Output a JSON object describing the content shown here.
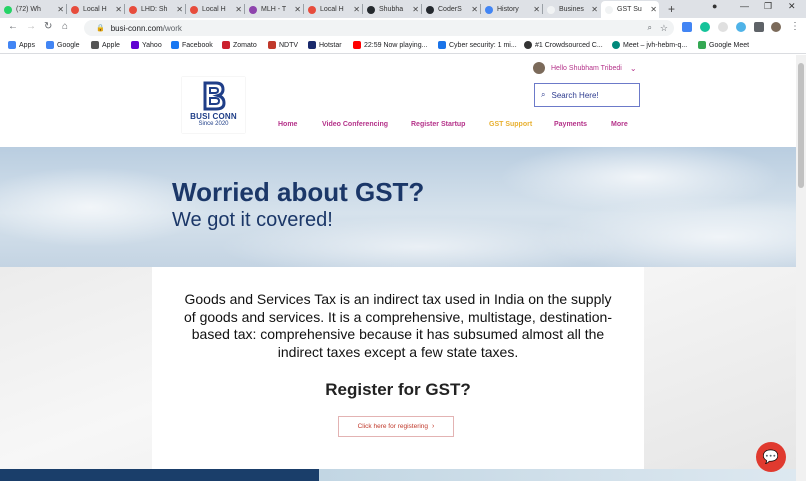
{
  "browser": {
    "tabs": [
      {
        "title": "(72) Wh",
        "color": "#25d366"
      },
      {
        "title": "Local H",
        "color": "#e74c3c"
      },
      {
        "title": "LHD: Sh",
        "color": "#e74c3c"
      },
      {
        "title": "Local H",
        "color": "#e74c3c"
      },
      {
        "title": "MLH - T",
        "color": "#8e44ad"
      },
      {
        "title": "Local H",
        "color": "#e74c3c"
      },
      {
        "title": "Shubha",
        "color": "#24292e"
      },
      {
        "title": "CoderS",
        "color": "#24292e"
      },
      {
        "title": "History",
        "color": "#4285f4"
      },
      {
        "title": "Busines",
        "color": "#f1f3f4"
      },
      {
        "title": "GST Su",
        "color": "#f1f3f4"
      }
    ],
    "new_tab_label": "+",
    "url_domain": "busi-conn.com",
    "url_path": "/work",
    "bookmarks": [
      {
        "label": "Apps",
        "color": "#4285f4"
      },
      {
        "label": "Google",
        "color": "#4285f4"
      },
      {
        "label": "Apple",
        "color": "#555555"
      },
      {
        "label": "Yahoo",
        "color": "#6001d2"
      },
      {
        "label": "Facebook",
        "color": "#1877f2"
      },
      {
        "label": "Zomato",
        "color": "#cb202d"
      },
      {
        "label": "NDTV",
        "color": "#c0392b"
      },
      {
        "label": "Hotstar",
        "color": "#1a2a6c"
      },
      {
        "label": "22:59 Now playing...",
        "color": "#ff0000"
      },
      {
        "label": "Cyber security: 1 mi...",
        "color": "#1a73e8"
      },
      {
        "label": "#1 Crowdsourced C...",
        "color": "#333333"
      },
      {
        "label": "Meet – jvh-hebm-q...",
        "color": "#00897b"
      },
      {
        "label": "Google Meet",
        "color": "#34a853"
      }
    ]
  },
  "site": {
    "logo": {
      "name": "BUSI CONN",
      "since": "Since 2020",
      "letter": "B"
    },
    "user_greeting": "Hello Shubham Tribedi",
    "search_placeholder": "Search Here!",
    "nav": [
      "Home",
      "Video Conferencing",
      "Register Startup",
      "GST Support",
      "Payments",
      "More"
    ],
    "active_nav": "GST Support",
    "hero": {
      "title": "Worried about GST?",
      "subtitle": "We got it covered!"
    },
    "card": {
      "body": "Goods and Services Tax is an indirect tax used in India on the supply of goods and services. It is a comprehensive, multistage, destination-based tax: comprehensive because it has subsumed almost all the indirect taxes except a few state taxes.",
      "heading": "Register for GST?",
      "button": "Click here for registering"
    }
  },
  "colors": {
    "brand": "#1f3e88",
    "accent": "#b5338a",
    "active": "#e8b030",
    "cta": "#c0392b"
  }
}
